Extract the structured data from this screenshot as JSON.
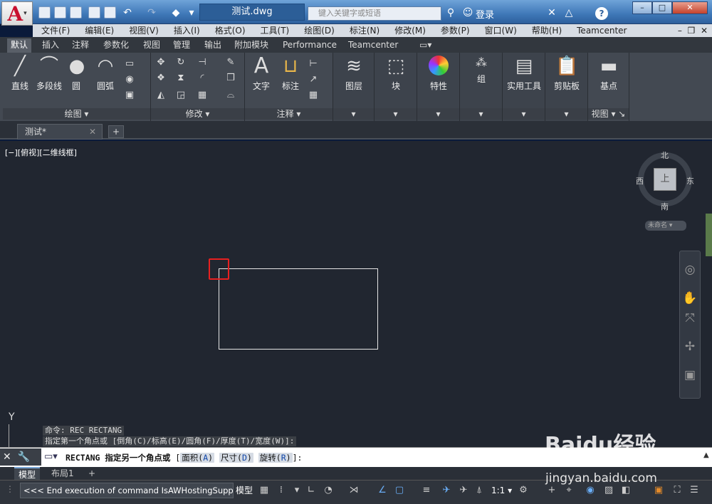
{
  "title_bar": {
    "app_icon_letter": "A",
    "document_title": "测试.dwg",
    "search_placeholder": "键入关键字或短语",
    "login_label": "登录",
    "help_label": "?"
  },
  "menu": {
    "items": [
      "文件(F)",
      "编辑(E)",
      "视图(V)",
      "插入(I)",
      "格式(O)",
      "工具(T)",
      "绘图(D)",
      "标注(N)",
      "修改(M)",
      "参数(P)",
      "窗口(W)",
      "帮助(H)",
      "Teamcenter"
    ]
  },
  "ribbon_tabs": [
    "默认",
    "插入",
    "注释",
    "参数化",
    "视图",
    "管理",
    "输出",
    "附加模块",
    "Performance",
    "Teamcenter"
  ],
  "active_ribbon_tab": "默认",
  "ribbon": {
    "draw": {
      "title": "绘图",
      "line": "直线",
      "polyline": "多段线",
      "circle": "圆",
      "arc": "圆弧"
    },
    "modify": {
      "title": "修改"
    },
    "annotation": {
      "title": "注释",
      "text": "文字",
      "dimension": "标注"
    },
    "layers": "图层",
    "block": "块",
    "properties": "特性",
    "groups": "组",
    "utilities": "实用工具",
    "clipboard": "剪贴板",
    "view": {
      "title": "视图",
      "base": "基点"
    }
  },
  "document_tab": {
    "label": "测试*"
  },
  "viewport_label": "[−][俯视][二维线框]",
  "viewcube": {
    "north": "北",
    "south": "南",
    "east": "东",
    "west": "西",
    "face": "上",
    "wcs": "未命名"
  },
  "axis_label": "Y",
  "command_history": [
    "命令: REC RECTANG",
    "指定第一个角点或 [倒角(C)/标高(E)/圆角(F)/厚度(T)/宽度(W)]:"
  ],
  "command_line": {
    "prompt": "RECTANG 指定另一个角点或",
    "options": [
      {
        "label": "面积(",
        "key": "A",
        "end": ")"
      },
      {
        "label": "尺寸(",
        "key": "D",
        "end": ")"
      },
      {
        "label": "旋转(",
        "key": "R",
        "end": ")"
      }
    ],
    "bracket_open": "[",
    "bracket_close": "]:"
  },
  "layout_tabs": [
    "模型",
    "布局1"
  ],
  "status": {
    "message": "<<< End execution of command IsAWHostingSupported",
    "model": "模型",
    "scale": "1:1"
  },
  "watermark": {
    "text": "Baidu经验",
    "url": "jingyan.baidu.com"
  },
  "colors": {
    "canvas": "#212630",
    "highlight": "#e82020",
    "rectangle": "#e6e6e6"
  }
}
